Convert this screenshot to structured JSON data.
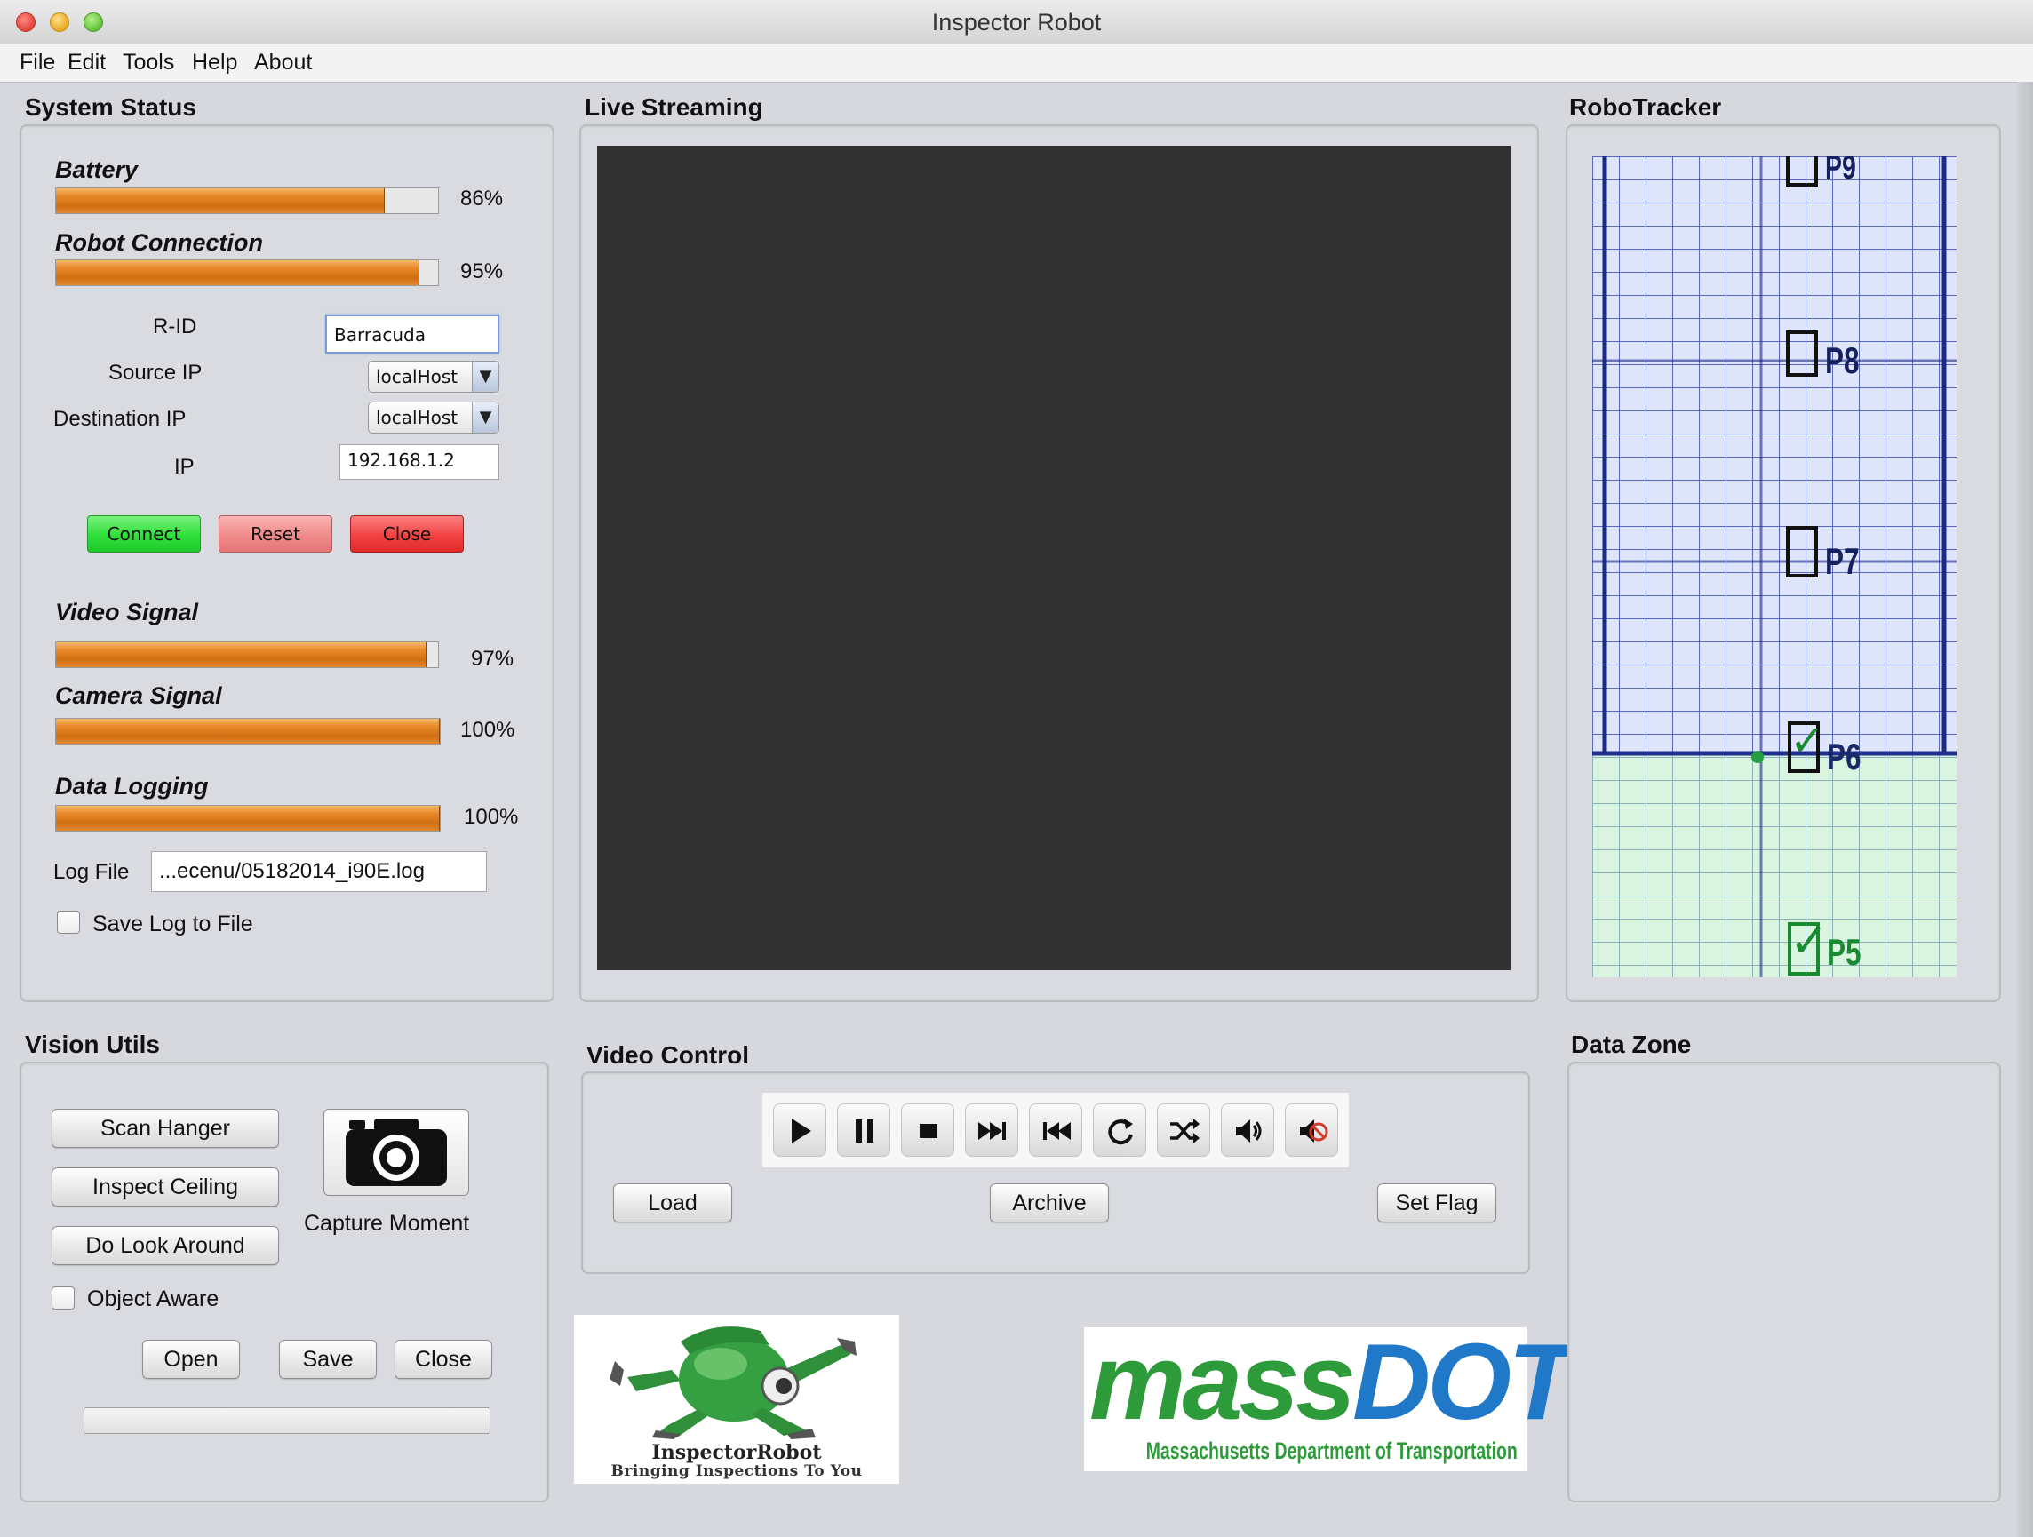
{
  "window": {
    "title": "Inspector Robot"
  },
  "menu": [
    "File",
    "Edit",
    "Tools",
    "Help",
    "About"
  ],
  "system_status": {
    "title": "System Status",
    "battery": {
      "label": "Battery",
      "value": 0.86,
      "text": "86%"
    },
    "robot_connection": {
      "label": "Robot Connection",
      "value": 0.95,
      "text": "95%"
    },
    "rid_label": "R-ID",
    "rid_value": "Barracuda",
    "source_ip_label": "Source IP",
    "source_ip_value": "localHost",
    "dest_ip_label": "Destination IP",
    "dest_ip_value": "localHost",
    "ip_label": "IP",
    "ip_value": "192.168.1.2",
    "connect_label": "Connect",
    "reset_label": "Reset",
    "close_label": "Close",
    "video_signal": {
      "label": "Video Signal",
      "value": 0.97,
      "text": "97%"
    },
    "camera_signal": {
      "label": "Camera Signal",
      "value": 1.0,
      "text": "100%"
    },
    "data_logging": {
      "label": "Data Logging",
      "value": 1.0,
      "text": "100%"
    },
    "log_file_label": "Log File",
    "log_file_value": "...ecenu/05182014_i90E.log",
    "save_log_label": "Save Log to File",
    "colors": {
      "connect": "#2ee03a",
      "reset": "#f08a8a",
      "close": "#f24242",
      "bar": "#e0801f"
    }
  },
  "live_streaming": {
    "title": "Live Streaming"
  },
  "robotracker": {
    "title": "RoboTracker",
    "markers": [
      {
        "label": "P9",
        "checked": false
      },
      {
        "label": "P8",
        "checked": false
      },
      {
        "label": "P7",
        "checked": false
      },
      {
        "label": "P6",
        "checked": true
      },
      {
        "label": "P5",
        "checked": true
      }
    ]
  },
  "vision_utils": {
    "title": "Vision Utils",
    "scan_hanger": "Scan Hanger",
    "inspect_ceiling": "Inspect Ceiling",
    "do_look_around": "Do Look Around",
    "capture_moment": "Capture Moment",
    "object_aware": "Object Aware",
    "open": "Open",
    "save": "Save",
    "close": "Close",
    "progress": 0,
    "camera_icon": "camera-icon"
  },
  "video_control": {
    "title": "Video Control",
    "media_buttons": [
      "play-icon",
      "pause-icon",
      "stop-icon",
      "fast-forward-icon",
      "rewind-icon",
      "repeat-icon",
      "shuffle-icon",
      "volume-icon",
      "mute-icon"
    ],
    "load": "Load",
    "archive": "Archive",
    "set_flag": "Set Flag"
  },
  "data_zone": {
    "title": "Data Zone"
  },
  "logos": {
    "inspector_robot": {
      "line1": "InspectorRobot",
      "line2": "Bringing Inspections To You"
    },
    "massdot": {
      "mass": "mass",
      "dot": "DOT",
      "subtitle": "Massachusetts Department of Transportation",
      "green": "#2e9b3a",
      "blue": "#1f78c8"
    }
  }
}
